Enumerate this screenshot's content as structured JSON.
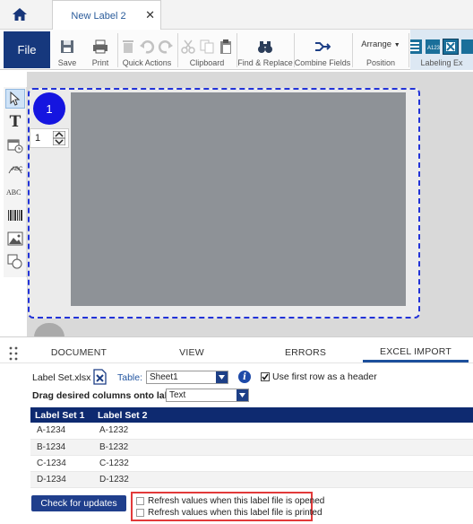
{
  "tab": {
    "title": "New Label 2",
    "close": "✕"
  },
  "ribbon": {
    "file": "File",
    "groups": {
      "save": "Save",
      "print": "Print",
      "quick_actions": "Quick Actions",
      "clipboard": "Clipboard",
      "find_replace": "Find & Replace",
      "combine_fields": "Combine Fields",
      "position": "Position",
      "arrange": "Arrange",
      "labeling": "Labeling Ex"
    }
  },
  "canvas": {
    "page_number": "1",
    "copies": "1"
  },
  "panel": {
    "tabs": [
      "DOCUMENT",
      "VIEW",
      "ERRORS",
      "EXCEL IMPORT"
    ],
    "active_tab": "EXCEL IMPORT",
    "file_name": "Label Set.xlsx",
    "table_label": "Table:",
    "table_value": "Sheet1",
    "first_row_header": "Use first row as a header",
    "first_row_header_checked": true,
    "drag_label": "Drag desired columns onto label:",
    "column_type": "Text",
    "columns": [
      "Label Set 1",
      "Label Set 2"
    ],
    "rows": [
      [
        "A-1234",
        "A-1232"
      ],
      [
        "B-1234",
        "B-1232"
      ],
      [
        "C-1234",
        "C-1232"
      ],
      [
        "D-1234",
        "D-1232"
      ]
    ],
    "update_button": "Check for updates",
    "refresh_opened": "Refresh values when this label file is opened",
    "refresh_printed": "Refresh values when this label file is printed"
  },
  "colors": {
    "accent": "#16387d",
    "selection": "#2233d8",
    "label_face": "#8e9297",
    "highlight": "#e23a3a"
  }
}
